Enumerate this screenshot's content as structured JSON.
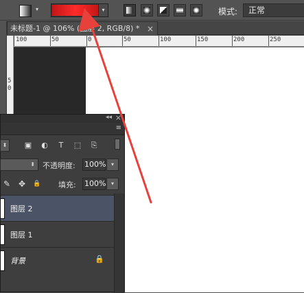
{
  "options_bar": {
    "tool_preset_arrow": "▾",
    "gradient_color_start": "#c41616",
    "gradient_color_mid": "#ff2b2b",
    "gradient_dropdown_arrow": "▾",
    "gradient_types": [
      "linear-gradient-icon",
      "radial-gradient-icon",
      "angle-gradient-icon",
      "reflected-gradient-icon",
      "diamond-gradient-icon"
    ],
    "mode_label": "模式:",
    "mode_value": "正常"
  },
  "document": {
    "tab_title": "未标题-1 @ 106% (图层 2, RGB/8) *",
    "close_glyph": "×"
  },
  "rulers": {
    "horizontal_labels": [
      "100",
      "50",
      "0",
      "50",
      "100",
      "150",
      "200",
      "250"
    ],
    "vertical_labels": [
      "5",
      "0"
    ]
  },
  "layers_panel": {
    "collapse_glyph": "◂◂",
    "close_glyph": "×",
    "menu_glyph": "≡",
    "kind_dropdown": "⬍",
    "filter_icons": [
      "▣",
      "◐",
      "T",
      "⬚",
      "⎘"
    ],
    "blend_dropdown": "⬍",
    "opacity_label": "不透明度:",
    "opacity_value": "100%",
    "dropdown_glyph": "▾",
    "lock_icons": [
      "✎",
      "✥",
      "🔒"
    ],
    "fill_label": "填充:",
    "fill_value": "100%",
    "layers": [
      {
        "name": "图层 2",
        "selected": true,
        "locked": false
      },
      {
        "name": "图层 1",
        "selected": false,
        "locked": false
      },
      {
        "name": "背景",
        "selected": false,
        "locked": true
      }
    ],
    "lock_glyph": "🔒"
  },
  "annotation": {
    "color": "#e8413c"
  }
}
